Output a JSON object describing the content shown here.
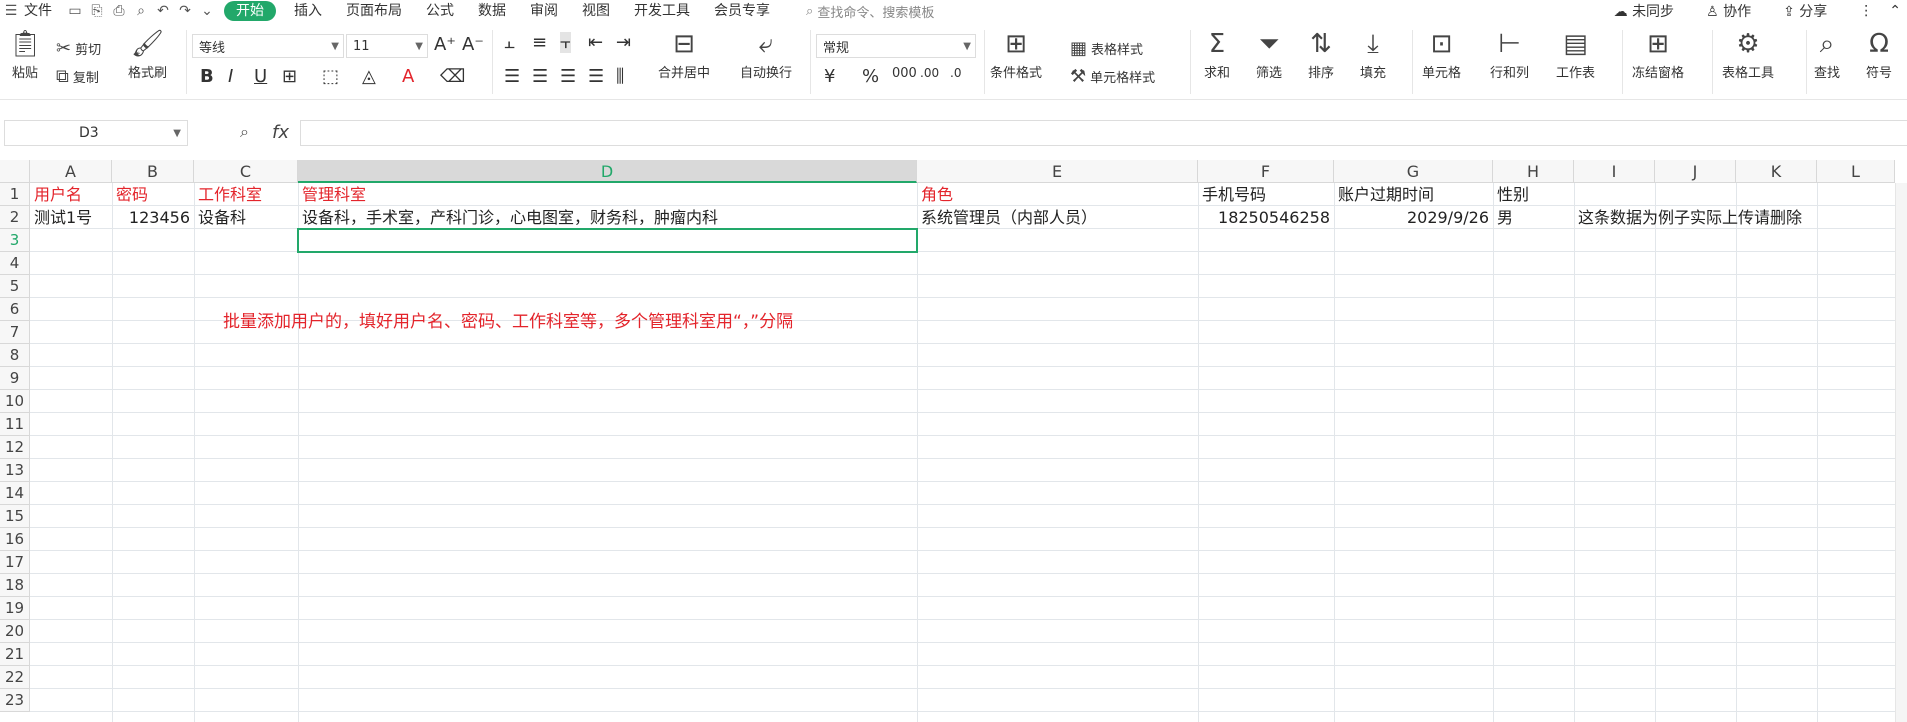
{
  "menubar": {
    "file": "文件",
    "tabs": [
      "开始",
      "插入",
      "页面布局",
      "公式",
      "数据",
      "审阅",
      "视图",
      "开发工具",
      "会员专享"
    ],
    "search_placeholder": "查找命令、搜索模板",
    "right": {
      "sync": "未同步",
      "collab": "协作",
      "share": "分享"
    }
  },
  "ribbon": {
    "paste": "粘贴",
    "cut": "剪切",
    "copy": "复制",
    "format_painter": "格式刷",
    "font_name": "等线",
    "font_size": "11",
    "merge_center": "合并居中",
    "wrap_text": "自动换行",
    "number_format": "常规",
    "cond_format": "条件格式",
    "table_style": "表格样式",
    "cell_style": "单元格样式",
    "sum": "求和",
    "filter": "筛选",
    "sort": "排序",
    "fill": "填充",
    "cell": "单元格",
    "row_col": "行和列",
    "worksheet": "工作表",
    "freeze": "冻结窗格",
    "table_tools": "表格工具",
    "find": "查找",
    "symbol": "符号"
  },
  "formula_bar": {
    "name_box": "D3",
    "fx": "fx",
    "content": ""
  },
  "sheet": {
    "columns": [
      "A",
      "B",
      "C",
      "D",
      "E",
      "F",
      "G",
      "H",
      "I",
      "J",
      "K",
      "L"
    ],
    "selected_column": "D",
    "rows": [
      "1",
      "2",
      "3",
      "4",
      "5",
      "6",
      "7",
      "8",
      "9",
      "10",
      "11",
      "12",
      "13",
      "14",
      "15",
      "16",
      "17",
      "18",
      "19",
      "20",
      "21",
      "22",
      "23"
    ],
    "selected_row": "3",
    "header_row": {
      "A": "用户名",
      "B": "密码",
      "C": "工作科室",
      "D": "管理科室",
      "E": "角色",
      "F": "手机号码",
      "G": "账户过期时间",
      "H": "性别"
    },
    "data_row": {
      "A": "测试1号",
      "B": "123456",
      "C": "设备科",
      "D": "设备科，手术室，产科门诊，心电图室，财务科，肿瘤内科",
      "E": "系统管理员（内部人员）",
      "F": "18250546258",
      "G": "2029/9/26",
      "H": "男",
      "I": "这条数据为例子实际上传请删除"
    },
    "note": "批量添加用户的，填好用户名、密码、工作科室等，多个管理科室用“，”分隔",
    "colors": {
      "header_red": "#e3242b",
      "selection_green": "#22a86a"
    }
  }
}
